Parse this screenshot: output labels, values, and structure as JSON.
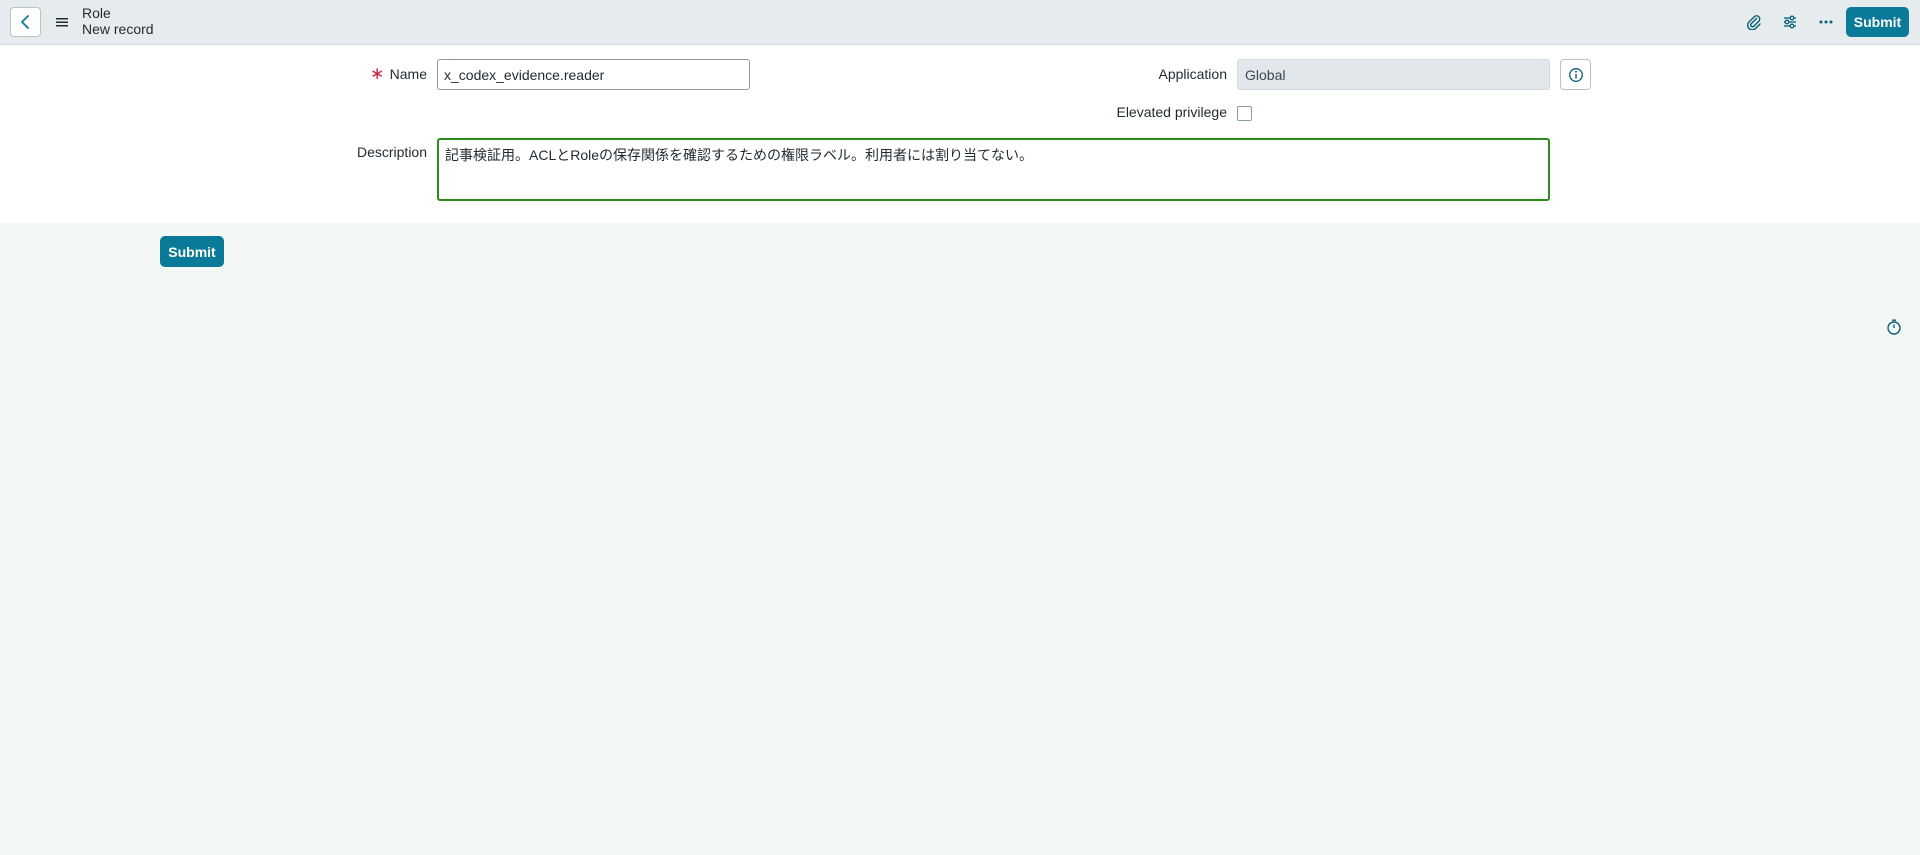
{
  "header": {
    "table_name": "Role",
    "record_title": "New record",
    "submit_label": "Submit"
  },
  "icons": {
    "back": "chevron-left-icon",
    "menu": "hamburger-menu-icon",
    "attachment": "paperclip-icon",
    "settings": "sliders-icon",
    "more": "more-horizontal-icon",
    "info": "info-icon",
    "timer": "stopwatch-icon"
  },
  "form": {
    "name": {
      "label": "Name",
      "required_marker": "∗",
      "value": "x_codex_evidence.reader"
    },
    "application": {
      "label": "Application",
      "value": "Global"
    },
    "elevated_privilege": {
      "label": "Elevated privilege",
      "checked": false
    },
    "description": {
      "label": "Description",
      "value": "記事検証用。ACLとRoleの保存関係を確認するための権限ラベル。利用者には割り当てない。"
    }
  },
  "footer": {
    "submit_label": "Submit"
  },
  "colors": {
    "accent": "#0a7a99",
    "focus_border": "#2e8b17",
    "required": "#c7253e",
    "header_bg": "#e6eced",
    "page_bg": "#f3f8f7"
  }
}
